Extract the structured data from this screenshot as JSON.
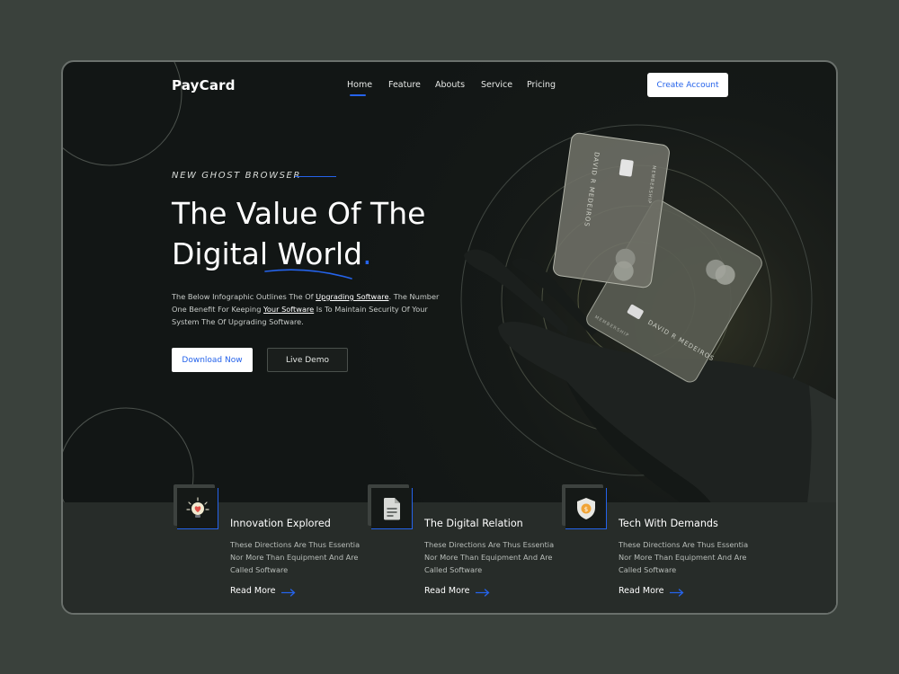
{
  "header": {
    "logo": "PayCard",
    "nav": [
      {
        "label": "Home",
        "active": true
      },
      {
        "label": "Feature"
      },
      {
        "label": "Abouts"
      },
      {
        "label": "Service"
      },
      {
        "label": "Pricing"
      }
    ],
    "cta": "Create Account"
  },
  "hero": {
    "eyebrow": "NEW GHOST BROWSER",
    "title_line1": "The Value Of The",
    "title_line2": "Digital World",
    "title_dot": ".",
    "desc_1": "The Below Infographic Outlines The Of ",
    "desc_link1": "Upgrading Software",
    "desc_2": ". The Number One Benefit For Keeping ",
    "desc_link2": "Your Software",
    "desc_3": " Is To Maintain Security Of Your System The Of Upgrading Software.",
    "primary_btn": "Download Now",
    "secondary_btn": "Live Demo"
  },
  "cards": {
    "card1": {
      "name": "DAVID R MEDEIROS",
      "label": "MEMBERSHIP"
    },
    "card2": {
      "name": "DAVID R MEDEIROS",
      "label": "MEMBERSHIP"
    }
  },
  "features": [
    {
      "title": "Innovation Explored",
      "text": "These Directions Are Thus Essentia Nor More Than Equipment And Are Called Software",
      "link": "Read More",
      "icon": "lightbulb-heart-icon"
    },
    {
      "title": "The Digital Relation",
      "text": "These Directions Are Thus Essentia Nor More Than Equipment And Are Called Software",
      "link": "Read More",
      "icon": "document-icon"
    },
    {
      "title": "Tech With Demands",
      "text": "These Directions Are Thus Essentia Nor More Than Equipment And Are Called Software",
      "link": "Read More",
      "icon": "shield-coin-icon"
    }
  ],
  "colors": {
    "accent": "#2563eb",
    "background": "#3a413c",
    "panel": "#121615",
    "band": "#272c29"
  }
}
